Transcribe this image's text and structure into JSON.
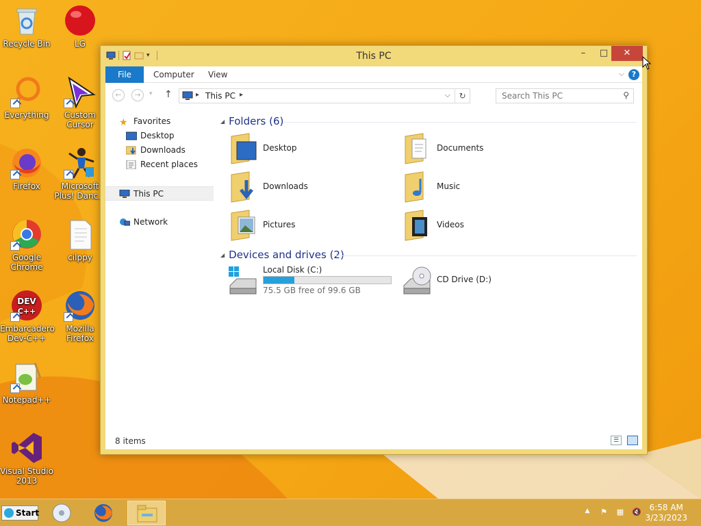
{
  "desktop": {
    "icons": [
      {
        "label": "Recycle Bin",
        "icon": "recycle-bin-icon"
      },
      {
        "label": "LG",
        "icon": "red-ball-icon"
      },
      {
        "label": "Everything",
        "icon": "everything-search-icon"
      },
      {
        "label": "Custom Cursor",
        "icon": "cursor-arrow-icon"
      },
      {
        "label": "Firefox",
        "icon": "firefox-icon"
      },
      {
        "label": "Microsoft Plus! Danc...",
        "icon": "dancer-icon"
      },
      {
        "label": "Google Chrome",
        "icon": "chrome-icon"
      },
      {
        "label": "cilppy",
        "icon": "text-file-icon"
      },
      {
        "label": "Embarcadero Dev-C++",
        "icon": "devcpp-icon"
      },
      {
        "label": "Mozilla Firefox",
        "icon": "firefox-icon"
      },
      {
        "label": "Notepad++",
        "icon": "notepadpp-icon"
      },
      {
        "label": "Visual Studio 2013",
        "icon": "visual-studio-icon"
      }
    ]
  },
  "window": {
    "title": "This PC",
    "controls": {
      "minimize": "–",
      "maximize": "□",
      "close": "✕"
    },
    "ribbon_tabs": [
      "File",
      "Computer",
      "View"
    ],
    "address": {
      "path": "This PC"
    },
    "search": {
      "placeholder": "Search This PC"
    },
    "nav_pane": {
      "favorites_label": "Favorites",
      "favorites": [
        "Desktop",
        "Downloads",
        "Recent places"
      ],
      "this_pc": "This PC",
      "network": "Network"
    },
    "folders_section": "Folders (6)",
    "folders": [
      "Desktop",
      "Documents",
      "Downloads",
      "Music",
      "Pictures",
      "Videos"
    ],
    "devices_section": "Devices and drives (2)",
    "drives": [
      {
        "name": "Local Disk (C:)",
        "free_text": "75.5 GB free of 99.6 GB",
        "used_fraction": 0.242
      },
      {
        "name": "CD Drive (D:)"
      }
    ],
    "status": "8 items"
  },
  "taskbar": {
    "start_label": "Start",
    "time": "6:58 AM",
    "date": "3/23/2023"
  },
  "colors": {
    "accent": "#1979ca",
    "window_frame": "#f2d97a",
    "close_button": "#c7463a",
    "drive_bar": "#26a0da"
  }
}
